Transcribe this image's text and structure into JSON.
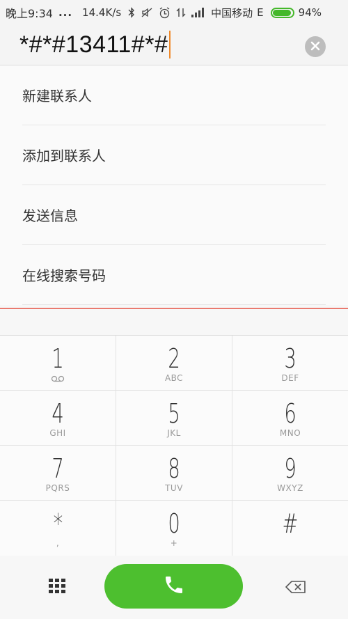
{
  "status_bar": {
    "time": "晚上9:34",
    "dots": "...",
    "speed": "14.4K/s",
    "carrier": "中国移动",
    "network": "E",
    "battery_pct": "94%",
    "battery_level": 0.94,
    "battery_color": "#44b82a"
  },
  "dialer": {
    "number": "*#*#13411#*#",
    "clear_icon": "clear-icon"
  },
  "suggestions": [
    {
      "label": "新建联系人"
    },
    {
      "label": "添加到联系人"
    },
    {
      "label": "发送信息"
    },
    {
      "label": "在线搜索号码"
    }
  ],
  "keypad": [
    {
      "digit": "1",
      "letters": ""
    },
    {
      "digit": "2",
      "letters": "ABC"
    },
    {
      "digit": "3",
      "letters": "DEF"
    },
    {
      "digit": "4",
      "letters": "GHI"
    },
    {
      "digit": "5",
      "letters": "JKL"
    },
    {
      "digit": "6",
      "letters": "MNO"
    },
    {
      "digit": "7",
      "letters": "PQRS"
    },
    {
      "digit": "8",
      "letters": "TUV"
    },
    {
      "digit": "9",
      "letters": "WXYZ"
    },
    {
      "digit": "*",
      "letters": ","
    },
    {
      "digit": "0",
      "letters": "+"
    },
    {
      "digit": "#",
      "letters": ""
    }
  ],
  "colors": {
    "call_button": "#4dbf2f",
    "caret": "#f08a2b",
    "divider": "#ea7a6f"
  }
}
